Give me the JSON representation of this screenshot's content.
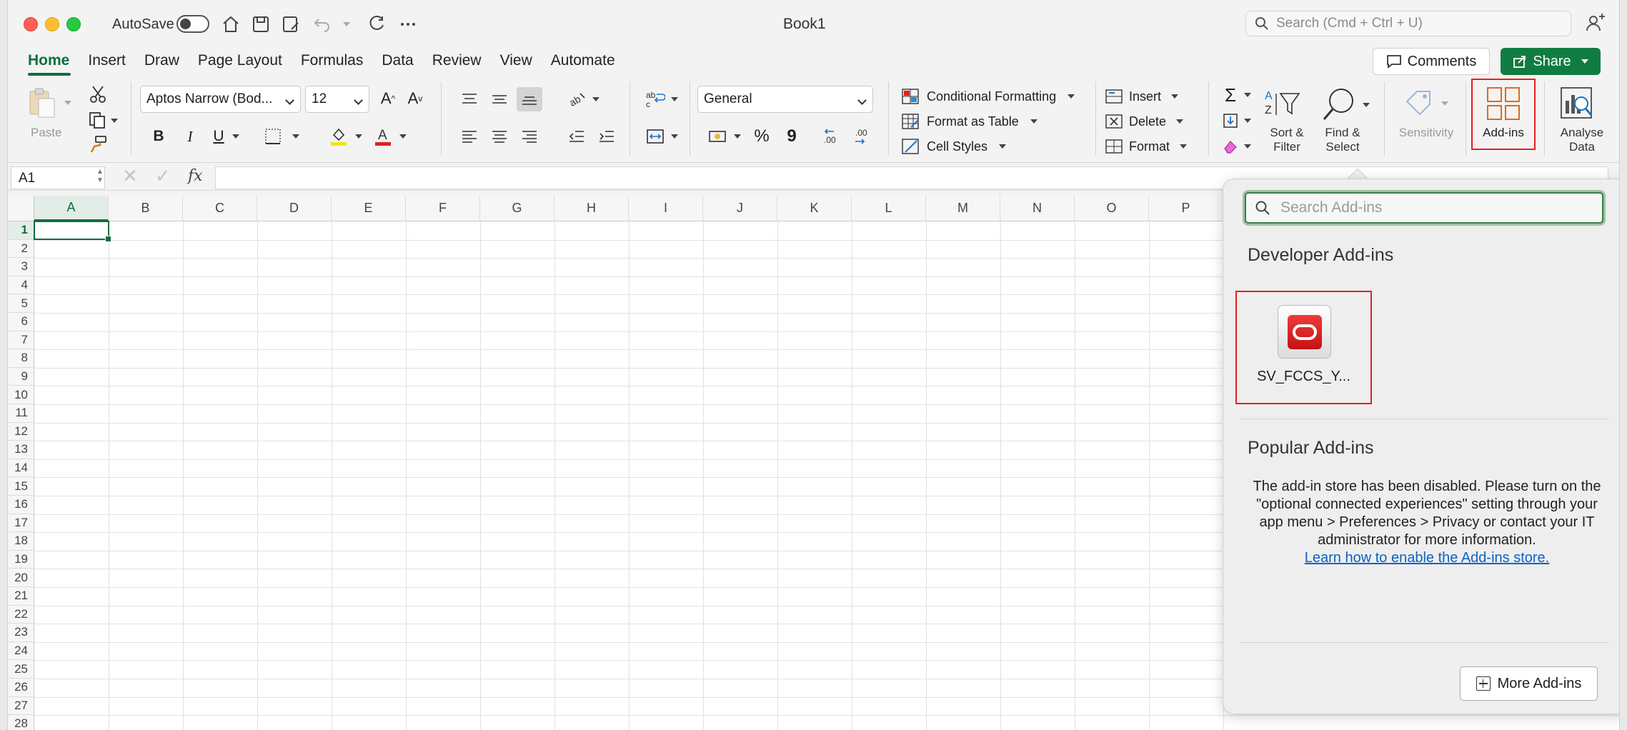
{
  "window": {
    "title": "Book1",
    "autosave_label": "AutoSave",
    "search_placeholder": "Search (Cmd + Ctrl + U)"
  },
  "tabs": [
    "Home",
    "Insert",
    "Draw",
    "Page Layout",
    "Formulas",
    "Data",
    "Review",
    "View",
    "Automate"
  ],
  "active_tab": "Home",
  "header_buttons": {
    "comments": "Comments",
    "share": "Share"
  },
  "ribbon": {
    "paste": "Paste",
    "font_name": "Aptos Narrow (Bod...",
    "font_size": "12",
    "bold": "B",
    "italic": "I",
    "underline": "U",
    "number_format": "General",
    "percent": "%",
    "comma": "9",
    "conditional_formatting": "Conditional Formatting",
    "format_as_table": "Format as Table",
    "cell_styles": "Cell Styles",
    "insert": "Insert",
    "delete": "Delete",
    "format": "Format",
    "sort_filter_1": "Sort &",
    "sort_filter_2": "Filter",
    "find_select_1": "Find &",
    "find_select_2": "Select",
    "sensitivity": "Sensitivity",
    "addins": "Add-ins",
    "analyse_1": "Analyse",
    "analyse_2": "Data"
  },
  "formula_bar": {
    "name_box": "A1",
    "fx": "fx",
    "formula": ""
  },
  "grid": {
    "columns": [
      "A",
      "B",
      "C",
      "D",
      "E",
      "F",
      "G",
      "H",
      "I",
      "J",
      "K",
      "L",
      "M",
      "N",
      "O",
      "P"
    ],
    "rows": [
      "1",
      "2",
      "3",
      "4",
      "5",
      "6",
      "7",
      "8",
      "9",
      "10",
      "11",
      "12",
      "13",
      "14",
      "15",
      "16",
      "17",
      "18",
      "19",
      "20",
      "21",
      "22",
      "23",
      "24",
      "25",
      "26",
      "27",
      "28"
    ],
    "selected_cell": "A1"
  },
  "addins_pane": {
    "search_placeholder": "Search Add-ins",
    "developer_heading": "Developer Add-ins",
    "developer_addins": [
      {
        "name": "SV_FCCS_Y..."
      }
    ],
    "popular_heading": "Popular Add-ins",
    "notice": "The add-in store has been disabled. Please turn on the \"optional connected experiences\" setting through your app menu > Preferences > Privacy or contact your IT administrator for more information.",
    "learn_link": "Learn how to enable the Add-ins store.",
    "more_button": "More Add-ins"
  },
  "colors": {
    "accent": "#0f6e3e",
    "share": "#107c41",
    "highlight_box": "#e31f26",
    "link": "#0b62c4"
  }
}
